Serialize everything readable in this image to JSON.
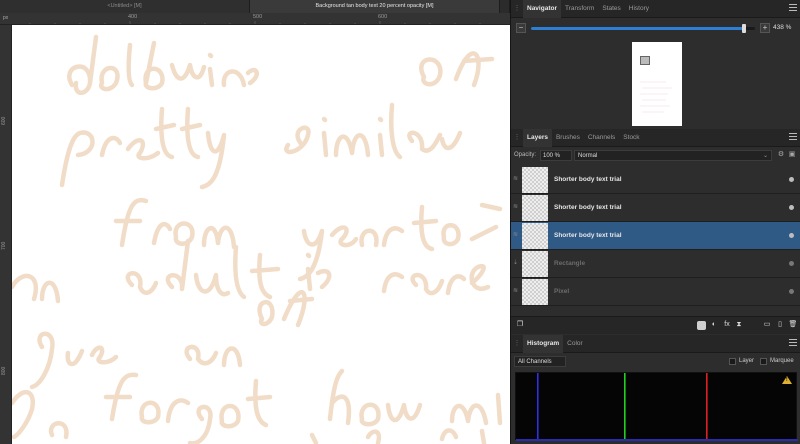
{
  "document": {
    "tabs": [
      "<Untitled> [M]",
      "Background tan body text 20 percent opacity [M]"
    ],
    "ruler_unit": "px",
    "ruler_top_labels": [
      "400",
      "500",
      "600"
    ],
    "ruler_left_labels": [
      "600",
      "700",
      "800"
    ]
  },
  "navigator": {
    "tabs": [
      "Navigator",
      "Transform",
      "States",
      "History"
    ],
    "zoom_minus": "−",
    "zoom_plus": "+",
    "zoom_value": "438 %",
    "zoom_fraction": 0.95
  },
  "layers": {
    "tabs": [
      "Layers",
      "Brushes",
      "Channels",
      "Stock"
    ],
    "opacity_label": "Opacity:",
    "opacity_value": "100 %",
    "blend_mode": "Normal",
    "items": [
      {
        "name": "Shorter body text trial",
        "selected": false,
        "dim": false
      },
      {
        "name": "Shorter body text trial",
        "selected": false,
        "dim": false
      },
      {
        "name": "Shorter body text trial",
        "selected": true,
        "dim": false
      },
      {
        "name": "Rectangle",
        "selected": false,
        "dim": true
      },
      {
        "name": "Pixel",
        "selected": false,
        "dim": true
      }
    ]
  },
  "histogram": {
    "tabs": [
      "Histogram",
      "Color"
    ],
    "channels": "All Channels",
    "layer_label": "Layer",
    "marquee_label": "Marquee",
    "warning_glyph": "!"
  },
  "colors": {
    "selected_layer": "#2f5a86",
    "handwriting": "#f1dcc8",
    "slider_fill": "#2e7fd1",
    "hist_red": "#e02020",
    "hist_green": "#20d020",
    "hist_blue": "#3030e0"
  }
}
